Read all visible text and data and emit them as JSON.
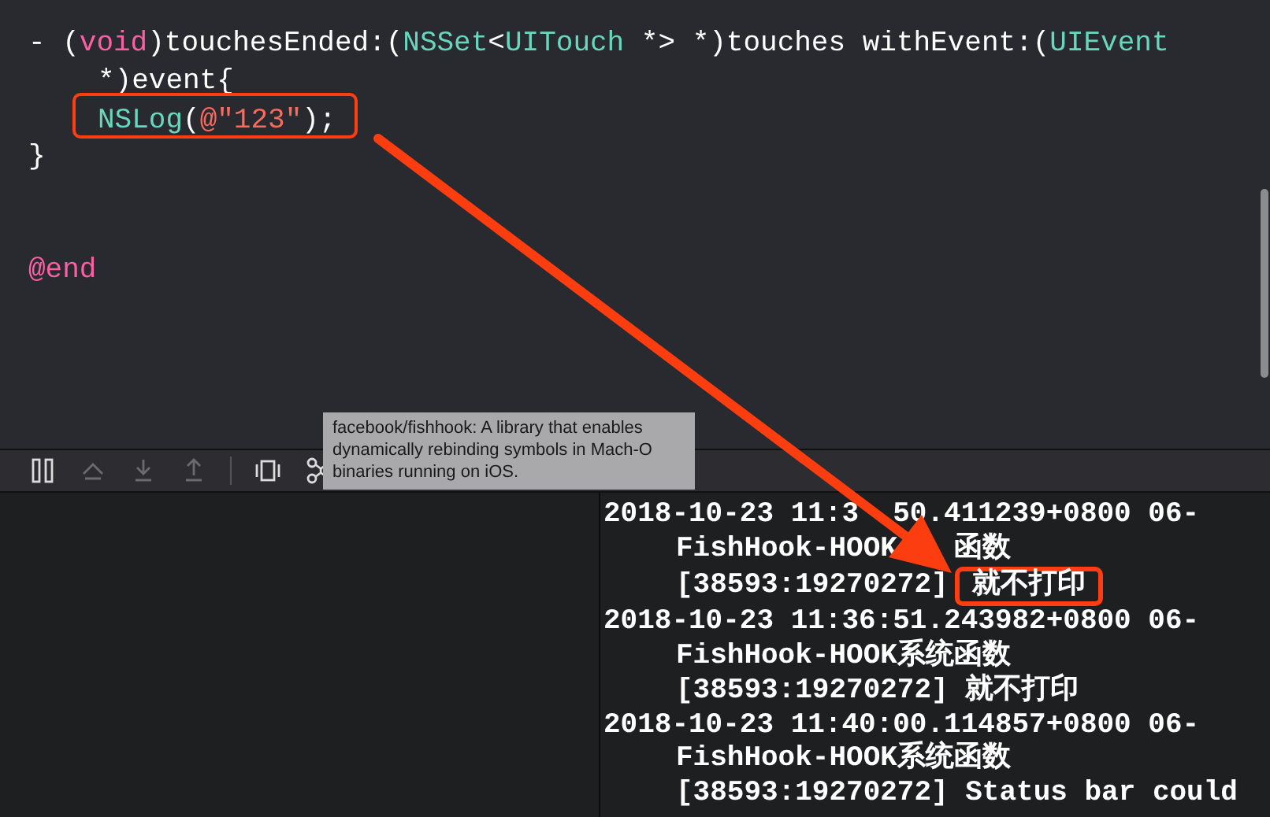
{
  "editor": {
    "lines": [
      {
        "kind": "code",
        "tokens": [
          {
            "kind": "plain",
            "text": "- ("
          },
          {
            "kind": "keyword",
            "text": "void"
          },
          {
            "kind": "plain",
            "text": ")touchesEnded:("
          },
          {
            "kind": "type",
            "text": "NSSet"
          },
          {
            "kind": "plain",
            "text": "<"
          },
          {
            "kind": "type",
            "text": "UITouch"
          },
          {
            "kind": "plain",
            "text": " *> *)touches withEvent:("
          },
          {
            "kind": "type",
            "text": "UIEvent"
          }
        ]
      },
      {
        "kind": "wrapped",
        "tokens": [
          {
            "kind": "plain",
            "text": "*)event{"
          }
        ]
      },
      {
        "kind": "indented",
        "boxed": true,
        "tokens": [
          {
            "kind": "type",
            "text": "NSLog"
          },
          {
            "kind": "plain",
            "text": "("
          },
          {
            "kind": "string",
            "text": "@\"123\""
          },
          {
            "kind": "plain",
            "text": ");"
          }
        ]
      },
      {
        "kind": "code",
        "tokens": [
          {
            "kind": "plain",
            "text": "}"
          }
        ]
      },
      {
        "kind": "blank"
      },
      {
        "kind": "blank"
      },
      {
        "kind": "code",
        "tokens": [
          {
            "kind": "keyword",
            "text": "@end"
          }
        ]
      }
    ]
  },
  "debug_bar": {
    "tools": [
      {
        "kind": "pause",
        "disabled": false
      },
      {
        "kind": "step_over",
        "disabled": true
      },
      {
        "kind": "step_into",
        "disabled": true
      },
      {
        "kind": "step_out",
        "disabled": true
      },
      {
        "kind": "view_debugger",
        "disabled": false
      },
      {
        "kind": "memory_graph",
        "disabled": false
      }
    ]
  },
  "tooltip": {
    "text": "facebook/fishhook: A library that enables dynamically rebinding symbols in Mach-O binaries running on iOS."
  },
  "console": {
    "entries": [
      {
        "kind": "fragments",
        "rows": [
          [
            {
              "kind": "narrow_cover",
              "text": "2018-10-23 11:3"
            },
            {
              "kind": "plain",
              "text": "50.411239+0800 06-"
            }
          ],
          [
            {
              "kind": "wide_cover",
              "text": "FishHook-HOOK"
            },
            {
              "kind": "plain",
              "text": "函数"
            }
          ],
          [
            {
              "kind": "plain",
              "text": "[38593:19270272]"
            }
          ]
        ],
        "highlight": "就不打印"
      },
      {
        "kind": "text",
        "text": "2018-10-23 11:36:51.243982+0800 06-FishHook-HOOK系统函数 [38593:19270272] 就不打印"
      },
      {
        "kind": "text",
        "text": "2018-10-23 11:40:00.114857+0800 06-FishHook-HOOK系统函数 [38593:19270272] Status bar could"
      }
    ]
  }
}
